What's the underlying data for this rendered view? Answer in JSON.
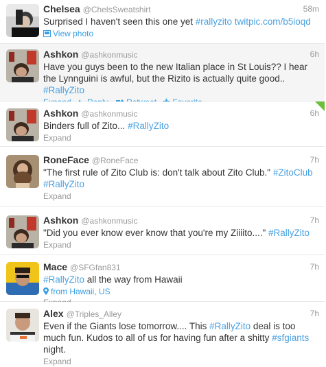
{
  "tweets": [
    {
      "name": "Chelsea",
      "handle": "@ChelsSweatshirt",
      "time": "58m",
      "text_plain": "Surprised I haven't seen this one yet ",
      "hashtag": "#rallyzito",
      "link": " twitpic.com/b5ioqd",
      "action": "View photo"
    },
    {
      "name": "Ashkon",
      "handle": "@ashkonmusic",
      "time": "6h",
      "text_plain": "Have you guys been to the new Italian place in St Louis?? I hear the Lynnguini is awful, but the Rizito is actually quite good.. ",
      "hashtag": "#RallyZito",
      "actions": {
        "expand": "Expand",
        "reply": "Reply",
        "retweet": "Retweet",
        "favorite": "Favorite"
      }
    },
    {
      "name": "Ashkon",
      "handle": "@ashkonmusic",
      "time": "6h",
      "text_plain": "Binders full of Zito... ",
      "hashtag": "#RallyZito",
      "action": "Expand"
    },
    {
      "name": "RoneFace",
      "handle": "@RoneFace",
      "time": "7h",
      "text_plain": "\"The first rule of Zito Club is: don't talk about Zito Club.\" ",
      "hashtag": "#ZitoClub",
      "hashtag2": "#RallyZito",
      "action": "Expand"
    },
    {
      "name": "Ashkon",
      "handle": "@ashkonmusic",
      "time": "7h",
      "text_plain": "\"Did you ever know ever know that you're my Ziiiito....\" ",
      "hashtag": "#RallyZito",
      "action": "Expand"
    },
    {
      "name": "Mace",
      "handle": "@SFGfan831",
      "time": "7h",
      "hashtag": "#RallyZito",
      "text_after": " all the way from Hawaii",
      "location": "from Hawaii, US",
      "action": "Expand"
    },
    {
      "name": "Alex",
      "handle": "@Triples_Alley",
      "time": "7h",
      "text_plain": "Even if the Giants lose tomorrow.... This ",
      "hashtag": "#RallyZito",
      "text_mid": " deal is too much fun. Kudos to all of us for having fun after a shitty ",
      "hashtag2": "#sfgiants",
      "text_after": " night.",
      "action": "Expand"
    }
  ],
  "colors": {
    "link": "#4aa1e0",
    "muted": "#999999",
    "hover_bg": "#f5f5f5",
    "accent": "#6bbf3a"
  }
}
